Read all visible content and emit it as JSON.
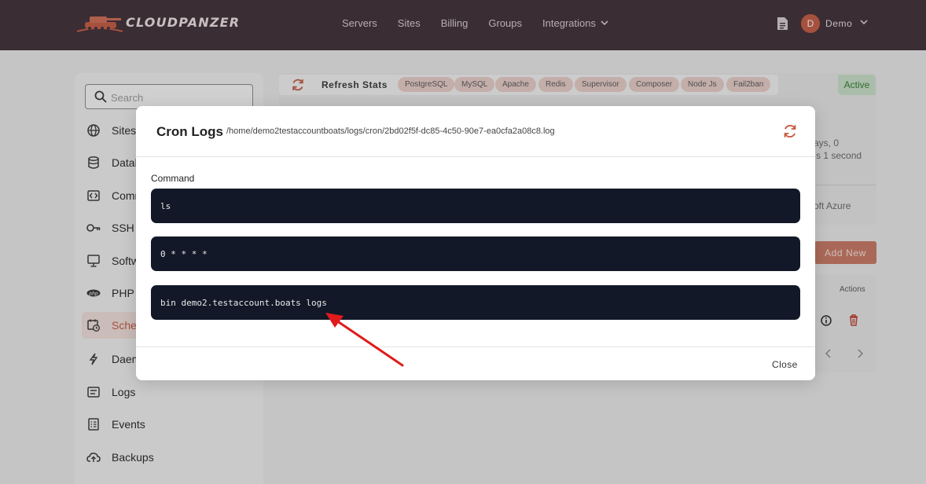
{
  "brand": {
    "name": "CLOUDPANZER"
  },
  "nav": {
    "items": [
      "Servers",
      "Sites",
      "Billing",
      "Groups",
      "Integrations"
    ]
  },
  "user": {
    "initial": "D",
    "name": "Demo"
  },
  "sidebar": {
    "search_placeholder": "Search",
    "items": [
      {
        "label": "Sites",
        "icon": "globe-icon"
      },
      {
        "label": "Datab",
        "icon": "database-icon"
      },
      {
        "label": "Comm",
        "icon": "code-icon"
      },
      {
        "label": "SSH K",
        "icon": "key-icon"
      },
      {
        "label": "Softw",
        "icon": "monitor-icon"
      },
      {
        "label": "PHP",
        "icon": "php-icon"
      },
      {
        "label": "Sche",
        "icon": "calendar-clock-icon",
        "active": true
      },
      {
        "label": "Daem",
        "icon": "bolt-icon"
      },
      {
        "label": "Logs",
        "icon": "list-icon"
      },
      {
        "label": "Events",
        "icon": "events-icon"
      },
      {
        "label": "Backups",
        "icon": "cloud-upload-icon"
      }
    ]
  },
  "stats": {
    "refresh_label": "Refresh Stats",
    "tags": [
      "PostgreSQL",
      "MySQL",
      "Apache",
      "Redis",
      "Supervisor",
      "Composer",
      "Node Js",
      "Fail2ban"
    ],
    "status": "Active"
  },
  "background": {
    "uptime_line1": "ays, 0",
    "uptime_line2": "s 1 second",
    "provider": "oft Azure",
    "add_new": "Add New",
    "actions": "Actions"
  },
  "modal": {
    "title": "Cron Logs",
    "path": "/home/demo2testaccountboats/logs/cron/2bd02f5f-dc85-4c50-90e7-ea0cfa2a08c8.log",
    "command_label": "Command",
    "command": "ls",
    "schedule": "0 * * * *",
    "output": "bin demo2.testaccount.boats logs",
    "close_label": "Close"
  },
  "colors": {
    "accent": "#c4583f",
    "header": "#3b2a32",
    "code_bg": "#121827",
    "annotation_arrow": "#e01b1b"
  }
}
